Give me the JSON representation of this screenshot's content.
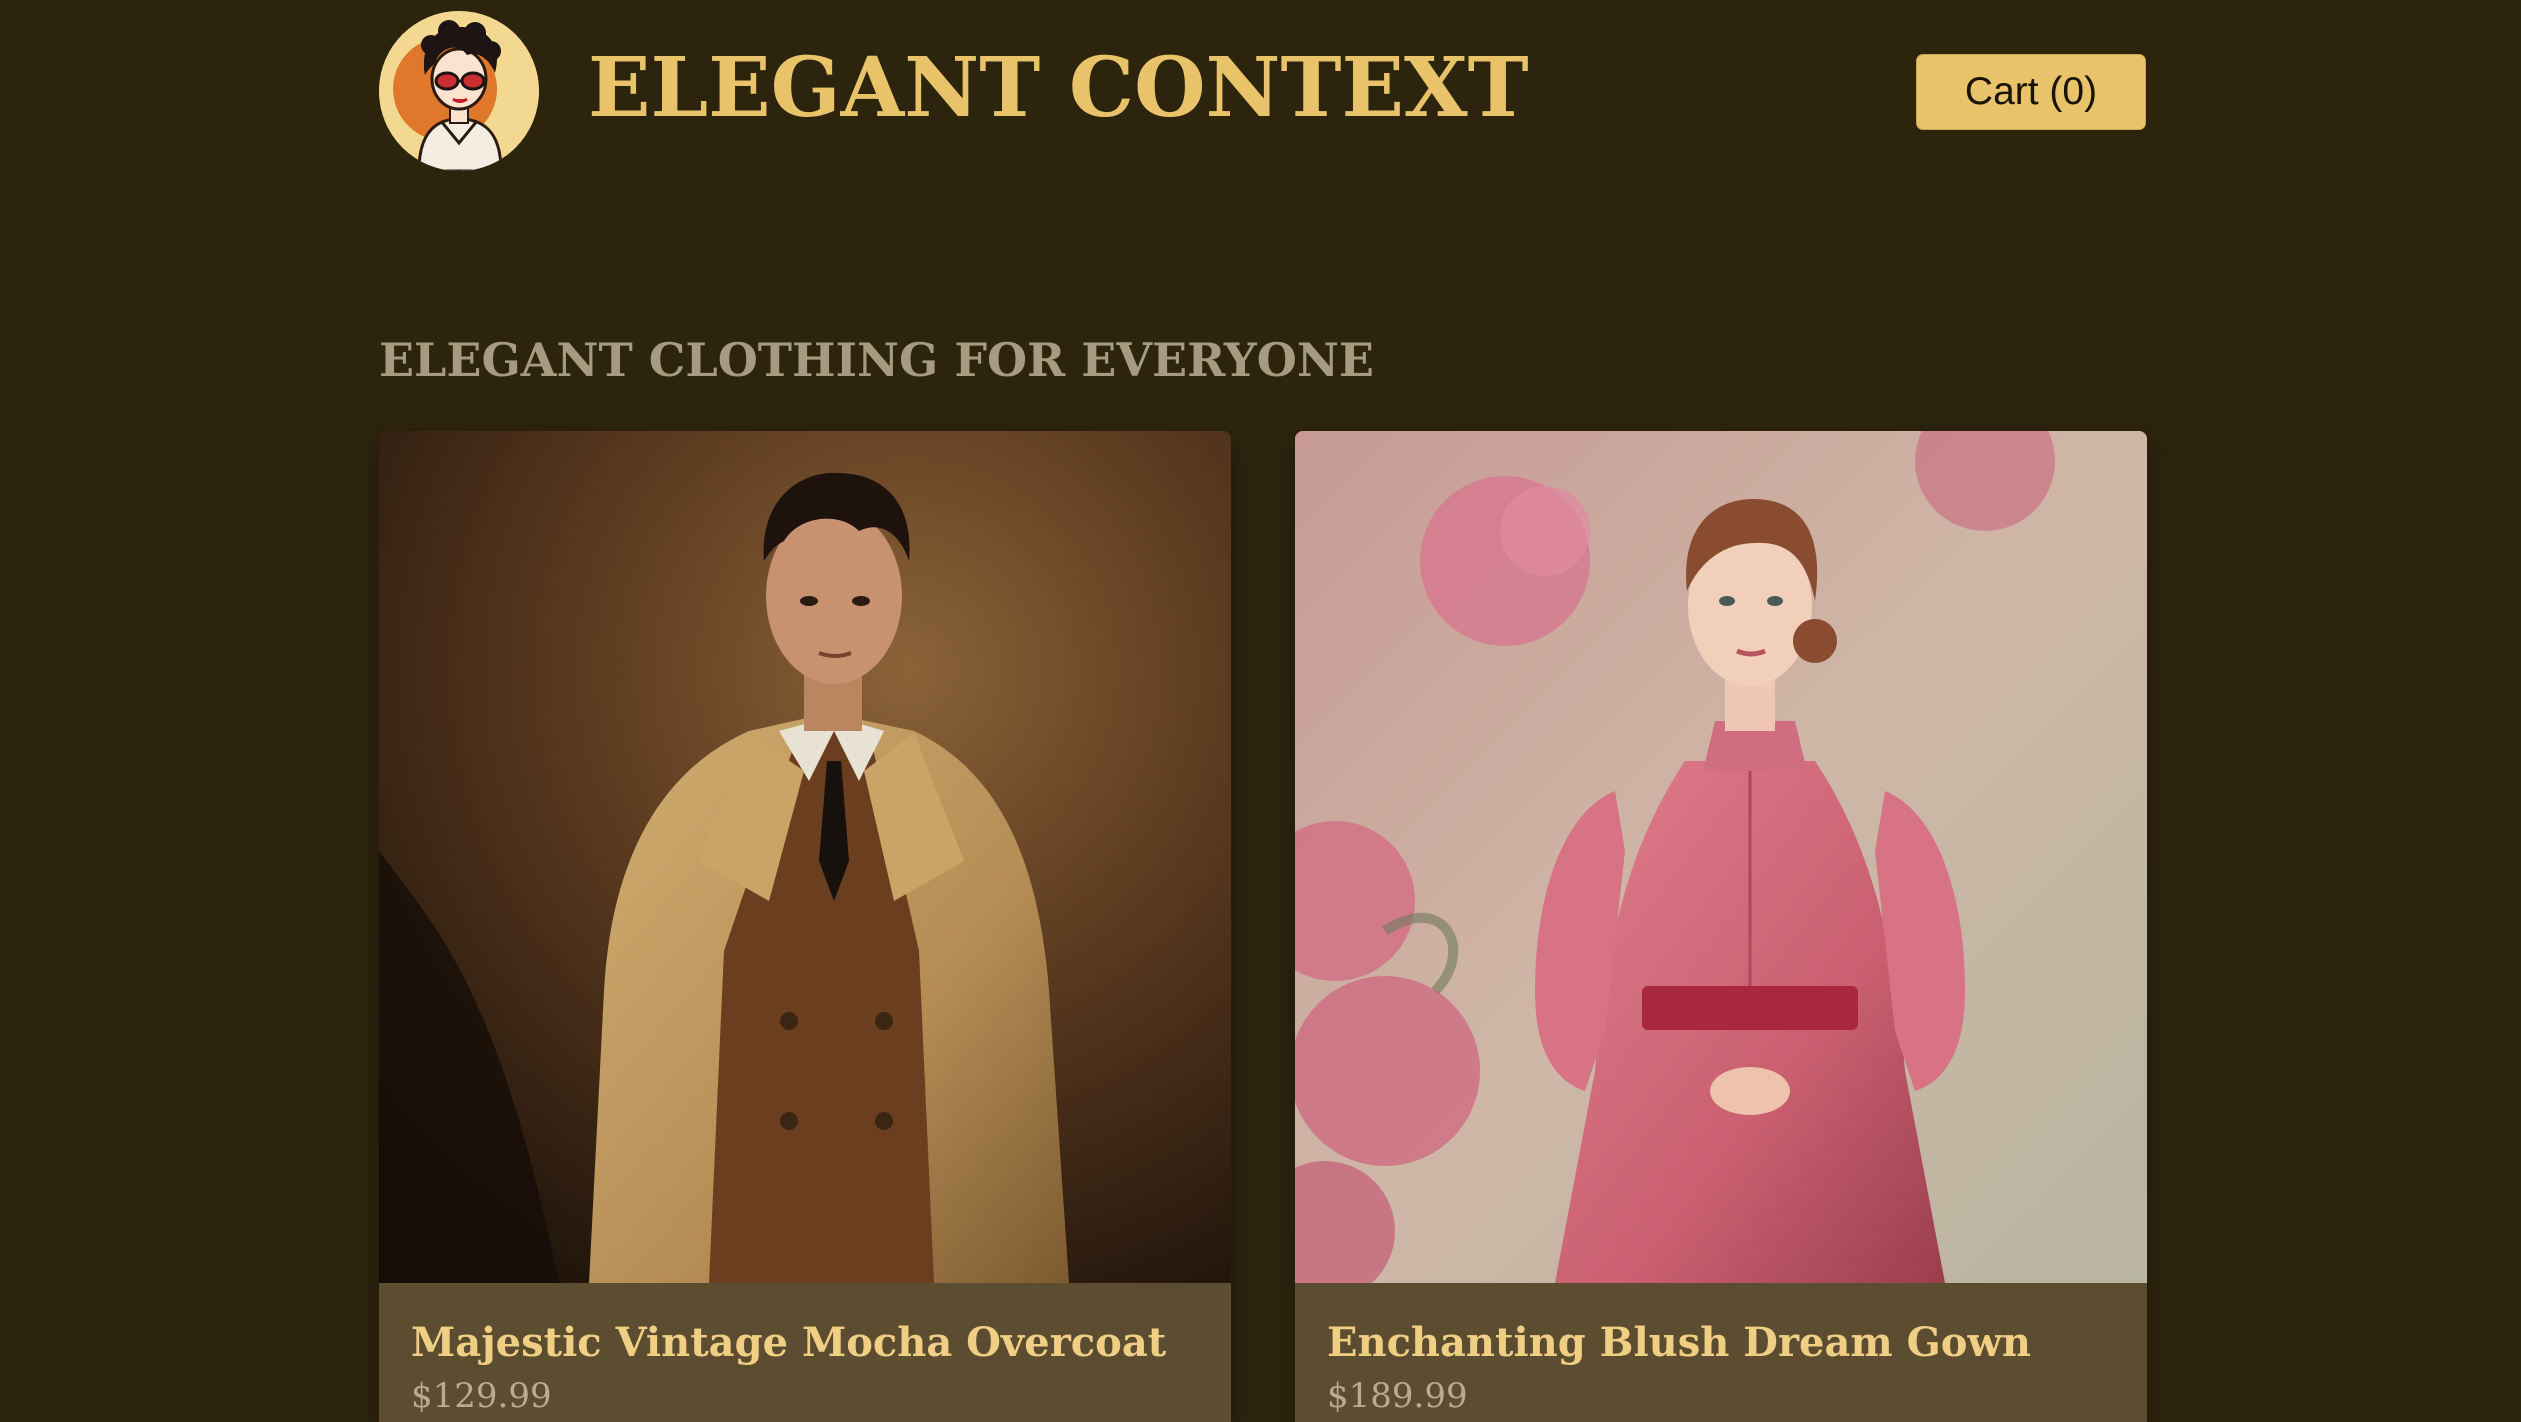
{
  "header": {
    "brand_title": "ELEGANT CONTEXT",
    "logo_icon": "vintage-woman-portrait-logo",
    "cart_label": "Cart (0)"
  },
  "main": {
    "section_title": "ELEGANT CLOTHING FOR EVERYONE",
    "products": [
      {
        "name": "Majestic Vintage Mocha Overcoat",
        "price": "$129.99",
        "image": "man-in-tan-trench-coat-photo"
      },
      {
        "name": "Enchanting Blush Dream Gown",
        "price": "$189.99",
        "image": "woman-in-pink-dress-photo"
      }
    ]
  },
  "colors": {
    "page_background": "#2d240d",
    "accent_gold": "#e8c36a",
    "card_background": "#5d4d30",
    "section_title": "#a69a80",
    "product_name": "#f0cf85",
    "product_price": "#b8ab90"
  }
}
